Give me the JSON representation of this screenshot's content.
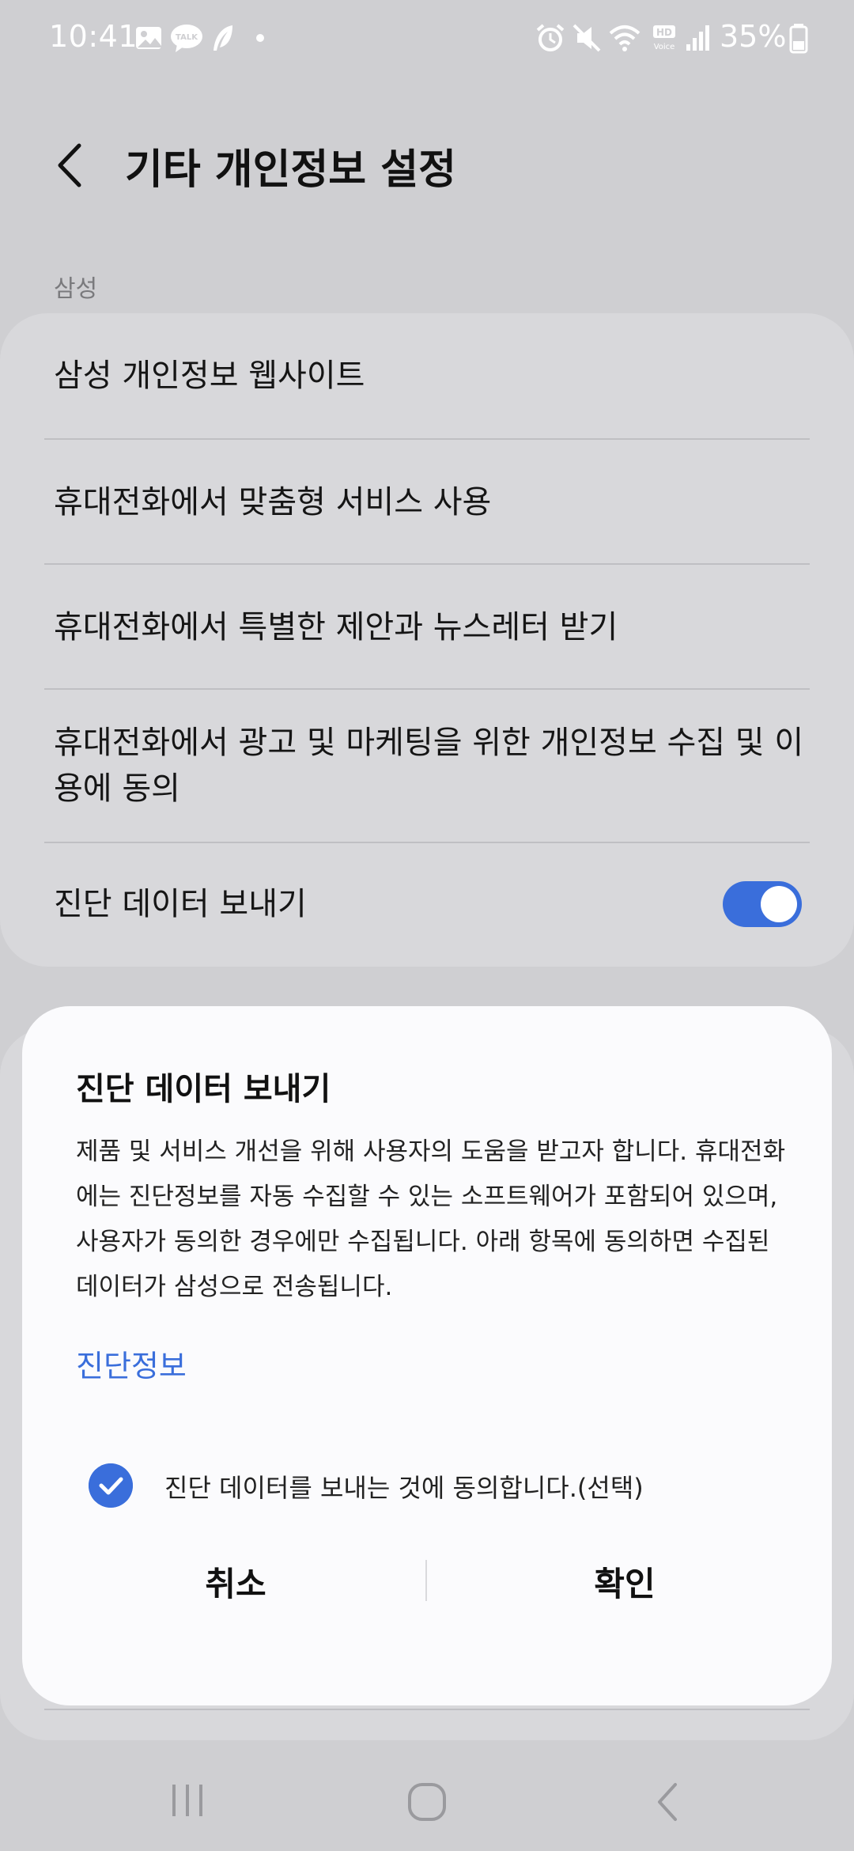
{
  "status_bar": {
    "time": "10:41",
    "battery": "35%",
    "icons": [
      "gallery-icon",
      "talk-icon",
      "feather-icon",
      "dot-icon",
      "alarm-icon",
      "mute-icon",
      "wifi-icon",
      "hd-voice-icon",
      "signal-icon",
      "battery-icon"
    ]
  },
  "header": {
    "title": "기타 개인정보 설정"
  },
  "section": {
    "label": "삼성",
    "items": [
      {
        "label": "삼성 개인정보 웹사이트"
      },
      {
        "label": "휴대전화에서 맞춤형 서비스 사용"
      },
      {
        "label": "휴대전화에서 특별한 제안과 뉴스레터 받기"
      },
      {
        "label": "휴대전화에서 광고 및 마케팅을 위한 개인정보 수집 및 이용에 동의"
      },
      {
        "label": "진단 데이터 보내기",
        "toggle_on": true
      }
    ]
  },
  "dialog": {
    "title": "진단 데이터 보내기",
    "body": "제품 및 서비스 개선을 위해 사용자의 도움을 받고자 합니다. 휴대전화에는 진단정보를 자동 수집할 수 있는 소프트웨어가 포함되어 있으며, 사용자가 동의한 경우에만 수집됩니다. 아래 항목에 동의하면 수집된 데이터가 삼성으로 전송됩니다.",
    "link": "진단정보",
    "checkbox_label": "진단 데이터를 보내는 것에 동의합니다.(선택)",
    "checked": true,
    "cancel": "취소",
    "confirm": "확인"
  },
  "colors": {
    "accent": "#3a6edb",
    "background": "#cfcfd2",
    "card": "#d8d8db",
    "dialog": "#fbfbfd"
  }
}
